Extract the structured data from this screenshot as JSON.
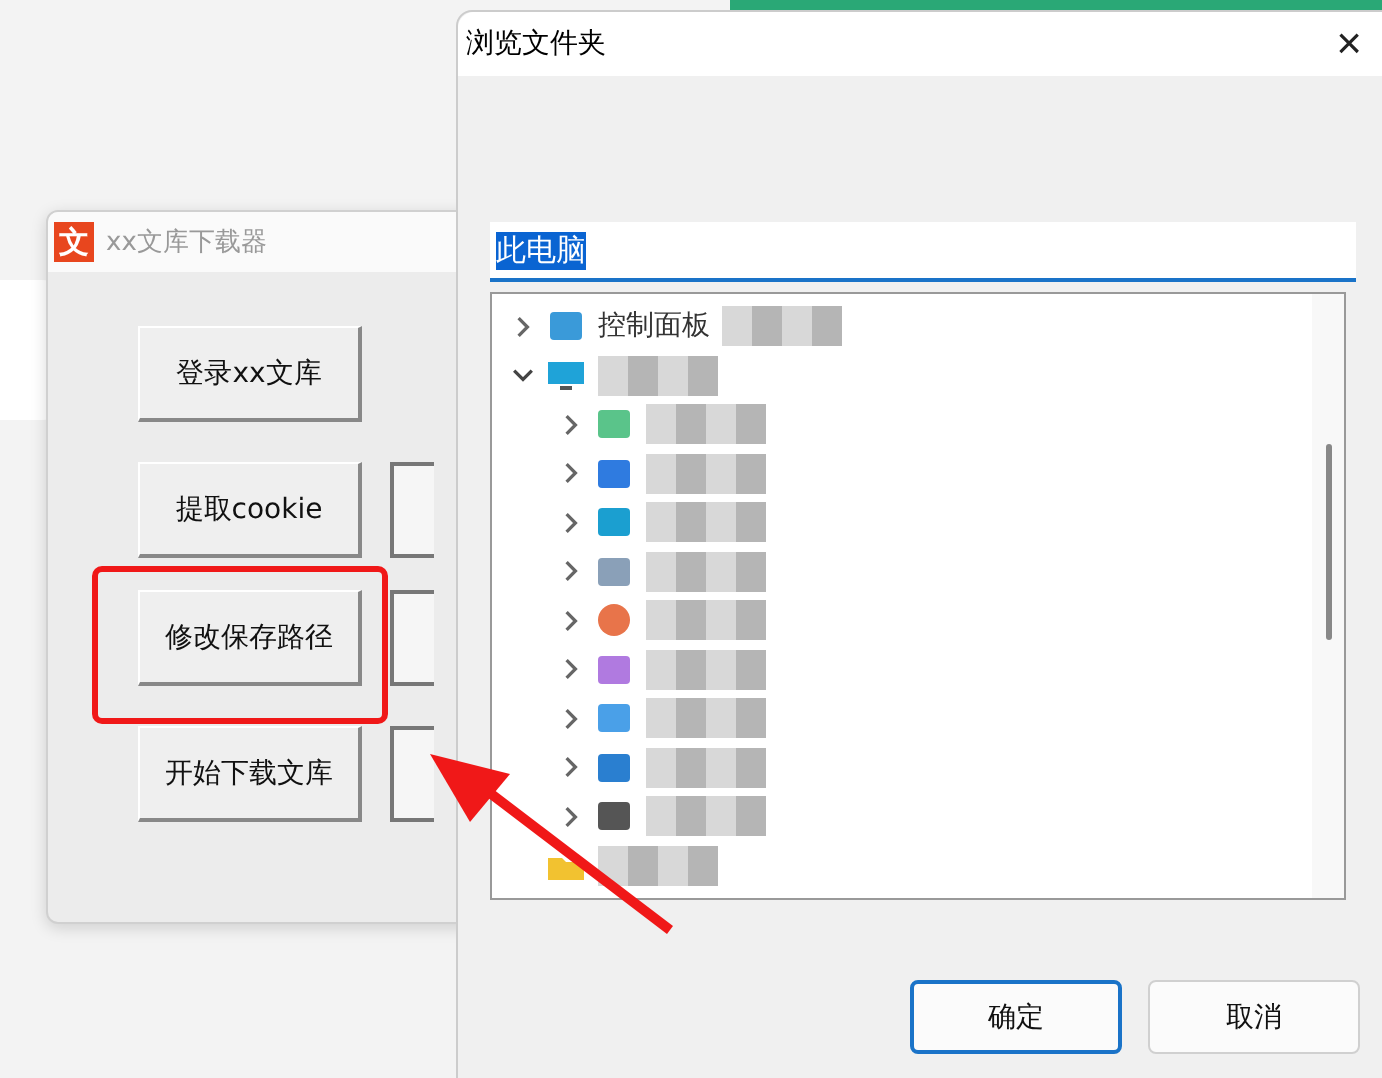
{
  "app_window": {
    "title": "xx文库下载器",
    "icon": "文",
    "buttons": [
      {
        "label": "登录xx文库",
        "highlighted": false
      },
      {
        "label": "提取cookie",
        "highlighted": false
      },
      {
        "label": "修改保存路径",
        "highlighted": true
      },
      {
        "label": "开始下载文库",
        "highlighted": false
      }
    ]
  },
  "dialog": {
    "title": "浏览文件夹",
    "close": "×",
    "path_field": {
      "value": "此电脑",
      "selected": true
    },
    "tree": [
      {
        "kind": "control-panel",
        "label": "控制面板",
        "expanded": false
      },
      {
        "kind": "computer",
        "expanded": true,
        "children": [
          {
            "kind": "download",
            "expanded": false
          },
          {
            "kind": "cloud",
            "expanded": false
          },
          {
            "kind": "drive",
            "expanded": false
          },
          {
            "kind": "document",
            "expanded": false
          },
          {
            "kind": "orange",
            "expanded": false
          },
          {
            "kind": "purple",
            "expanded": false
          },
          {
            "kind": "blue",
            "expanded": false
          },
          {
            "kind": "network",
            "expanded": false
          },
          {
            "kind": "disk",
            "expanded": false
          }
        ]
      },
      {
        "kind": "folder"
      }
    ],
    "buttons": [
      {
        "label": "确定",
        "default": true
      },
      {
        "label": "取消",
        "default": false
      }
    ]
  }
}
